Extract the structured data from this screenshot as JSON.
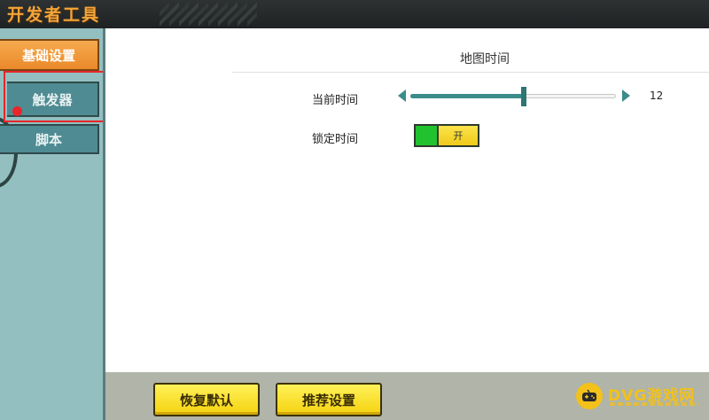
{
  "window": {
    "title": "开发者工具"
  },
  "sidebar": {
    "items": [
      {
        "label": "基础设置",
        "active": true
      },
      {
        "label": "触发器",
        "active": false
      },
      {
        "label": "脚本",
        "active": false
      }
    ]
  },
  "main": {
    "section_title": "地图时间",
    "current_time": {
      "label": "当前时间",
      "value": 12,
      "value_text": "12",
      "level_fraction": 0.55
    },
    "lock_time": {
      "label": "锁定时间",
      "toggle_text": "开",
      "on": true
    }
  },
  "footer": {
    "reset_label": "恢复默认",
    "recommend_label": "推荐设置"
  },
  "watermark": {
    "text": "DVG游戏网"
  },
  "colors": {
    "accent_teal": "#3b8c8a",
    "active_tab_orange": "#f0a040",
    "toggle_green": "#21c230",
    "button_yellow": "#f4d20f",
    "highlight_red": "#e8262a"
  }
}
